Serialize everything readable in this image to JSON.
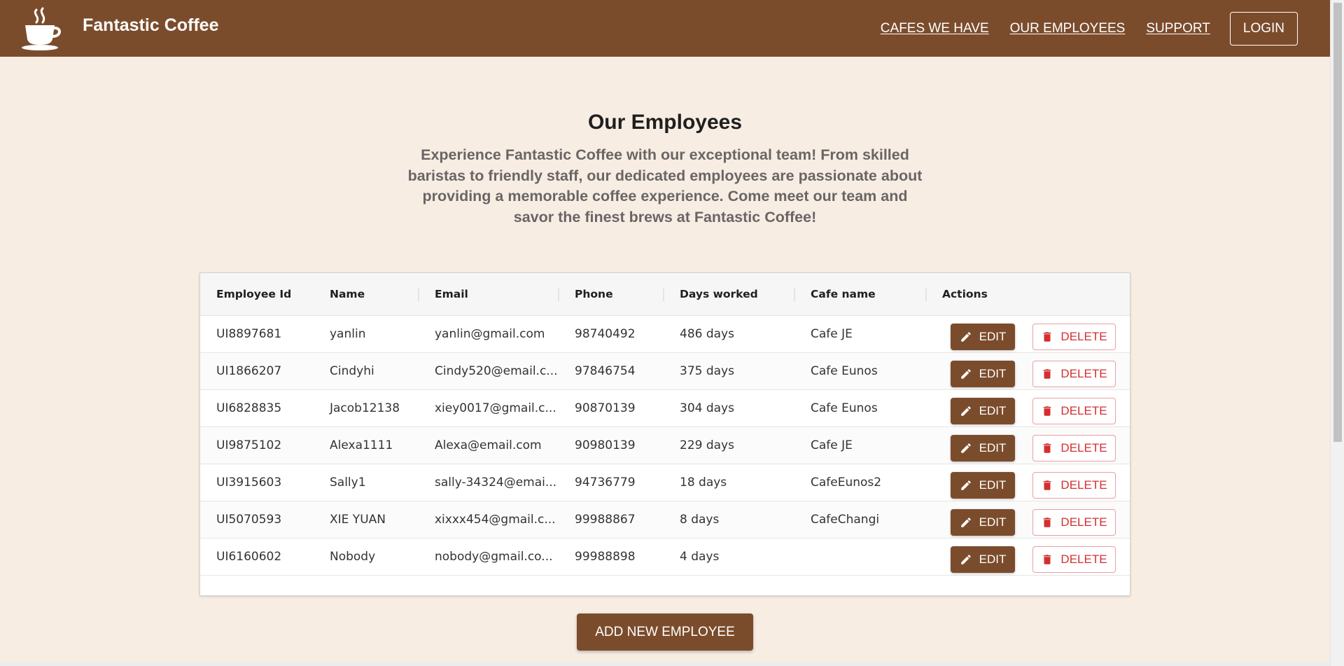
{
  "header": {
    "brand": "Fantastic Coffee",
    "logo_icon": "coffee-cup-icon",
    "nav": [
      "CAFES WE HAVE",
      "OUR EMPLOYEES",
      "SUPPORT"
    ],
    "login": "LOGIN",
    "bg_color": "#7b4c2c"
  },
  "hero": {
    "title": "Our Employees",
    "text": "Experience Fantastic Coffee with our exceptional team! From skilled baristas to friendly staff, our dedicated employees are passionate about providing a memorable coffee experience. Come meet our team and savor the finest brews at Fantastic Coffee!"
  },
  "table": {
    "columns": [
      "Employee Id",
      "Name",
      "Email",
      "Phone",
      "Days worked",
      "Cafe name",
      "Actions"
    ],
    "rows": [
      {
        "id": "UI8897681",
        "name": "yanlin",
        "email": "yanlin@gmail.com",
        "phone": "98740492",
        "days": "486 days",
        "cafe": "Cafe JE"
      },
      {
        "id": "UI1866207",
        "name": "Cindyhi",
        "email": "Cindy520@email.c...",
        "phone": "97846754",
        "days": "375 days",
        "cafe": "Cafe Eunos"
      },
      {
        "id": "UI6828835",
        "name": "Jacob12138",
        "email": "xiey0017@gmail.c...",
        "phone": "90870139",
        "days": "304 days",
        "cafe": "Cafe Eunos"
      },
      {
        "id": "UI9875102",
        "name": "Alexa1111",
        "email": "Alexa@email.com",
        "phone": "90980139",
        "days": "229 days",
        "cafe": "Cafe JE"
      },
      {
        "id": "UI3915603",
        "name": "Sally1",
        "email": "sally-34324@emai...",
        "phone": "94736779",
        "days": "18 days",
        "cafe": "CafeEunos2"
      },
      {
        "id": "UI5070593",
        "name": "XIE YUAN",
        "email": "xixxx454@gmail.c...",
        "phone": "99988867",
        "days": "8 days",
        "cafe": "CafeChangi"
      },
      {
        "id": "UI6160602",
        "name": "Nobody",
        "email": "nobody@gmail.co...",
        "phone": "99988898",
        "days": "4 days",
        "cafe": ""
      }
    ],
    "edit_label": "EDIT",
    "delete_label": "DELETE",
    "edit_icon": "pencil-icon",
    "delete_icon": "trash-icon"
  },
  "add_button": "ADD NEW EMPLOYEE",
  "colors": {
    "brand": "#7b4c2c",
    "background": "#f7ede3",
    "danger": "#d32f2f"
  }
}
